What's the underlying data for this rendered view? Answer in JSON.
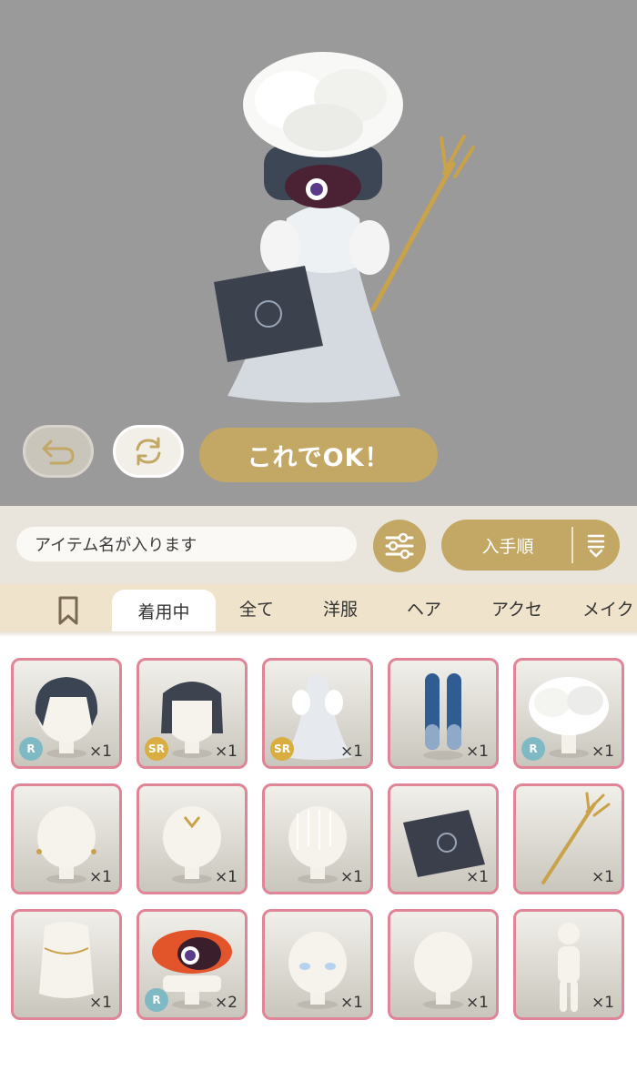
{
  "preview": {
    "ok_label": "これでOK！"
  },
  "toolbar": {
    "search_placeholder": "アイテム名が入ります",
    "sort_label": "入手順"
  },
  "tabs": [
    {
      "label": "着用中",
      "active": true
    },
    {
      "label": "全て",
      "active": false
    },
    {
      "label": "洋服",
      "active": false
    },
    {
      "label": "ヘア",
      "active": false
    },
    {
      "label": "アクセ",
      "active": false
    },
    {
      "label": "メイク",
      "active": false
    }
  ],
  "items": [
    {
      "icon": "black-bob-hair",
      "rarity": "R",
      "qty": "×1"
    },
    {
      "icon": "black-straight-hair",
      "rarity": "SR",
      "qty": "×1"
    },
    {
      "icon": "white-gown-dress",
      "rarity": "SR",
      "qty": "×1"
    },
    {
      "icon": "blue-tights",
      "rarity": "",
      "qty": "×1"
    },
    {
      "icon": "white-flower-headpiece",
      "rarity": "R",
      "qty": "×1"
    },
    {
      "icon": "gold-earrings",
      "rarity": "",
      "qty": "×1"
    },
    {
      "icon": "forehead-ornament",
      "rarity": "",
      "qty": "×1"
    },
    {
      "icon": "sparkle-veil",
      "rarity": "",
      "qty": "×1"
    },
    {
      "icon": "dark-book-clutch",
      "rarity": "",
      "qty": "×1"
    },
    {
      "icon": "gold-trident",
      "rarity": "",
      "qty": "×1"
    },
    {
      "icon": "gold-body-chain",
      "rarity": "",
      "qty": "×1"
    },
    {
      "icon": "goldfish-mask",
      "rarity": "R",
      "qty": "×2"
    },
    {
      "icon": "blue-eye-makeup",
      "rarity": "",
      "qty": "×1"
    },
    {
      "icon": "face-makeup",
      "rarity": "",
      "qty": "×1"
    },
    {
      "icon": "body-mannequin",
      "rarity": "",
      "qty": "×1"
    }
  ],
  "colors": {
    "accent_gold": "#c3a865",
    "stage_gray": "#9a9a9a",
    "item_border_pink": "#e08597",
    "rarity_r": "#7fb9c3",
    "rarity_sr": "#d9ad3f"
  }
}
